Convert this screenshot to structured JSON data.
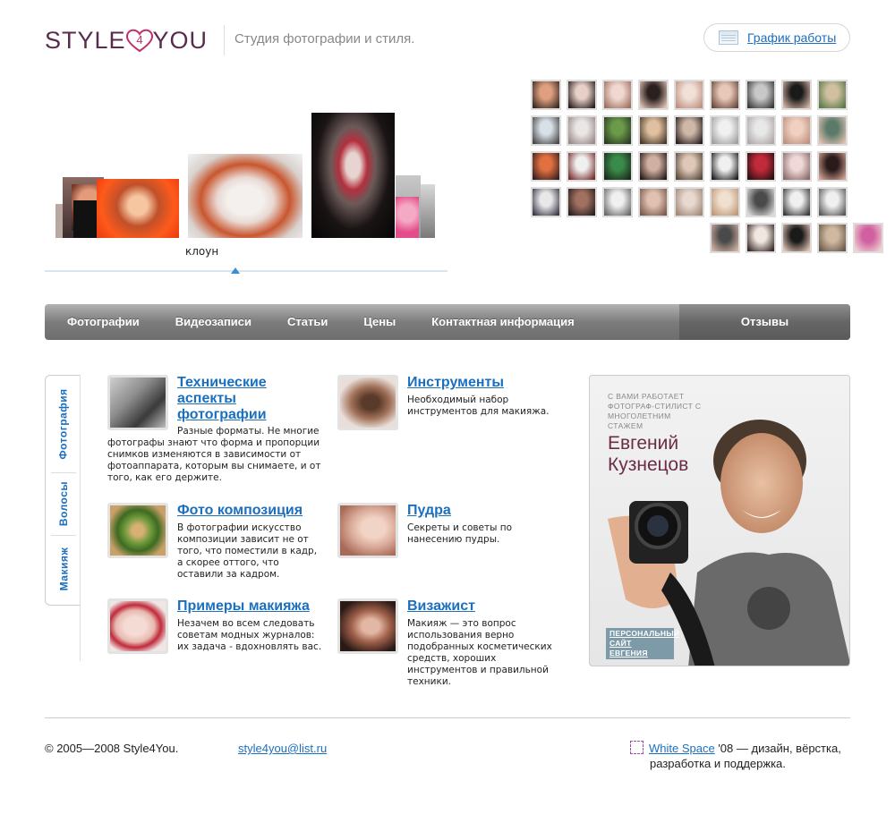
{
  "header": {
    "logo_left": "STYLE",
    "logo_digit": "4",
    "logo_right": "YOU",
    "tagline": "Студия фотографии и стиля.",
    "schedule_label": "График работы",
    "schedule_icon": "calendar-icon"
  },
  "carousel": {
    "active_caption": "клоун"
  },
  "nav": {
    "items": [
      "Фотографии",
      "Видеозаписи",
      "Статьи",
      "Цены",
      "Контактная информация"
    ],
    "reviews": "Отзывы"
  },
  "side_tabs": [
    "Фотография",
    "Волосы",
    "Макияж"
  ],
  "articles": [
    {
      "title": "Технические аспекты фотографии",
      "text": "Разные форматы. Не многие фотографы знают что форма и пропорции снимков изменяются в зависимости от фотоаппарата, которым вы снимаете, и от того, как его держите."
    },
    {
      "title": "Инструменты",
      "text": "Необходимый набор инструментов для макияжа."
    },
    {
      "title": "Фото композиция",
      "text": "В фотографии искусство композиции зависит не от того, что поместили в кадр, а скорее оттого, что оставили за кадром."
    },
    {
      "title": "Пудра",
      "text": "Секреты и советы по нанесению пудры."
    },
    {
      "title": "Примеры макияжа",
      "text": "Незачем во всем следовать советам модных журналов: их задача - вдохновлять вас."
    },
    {
      "title": "Визажист",
      "text": "Макияж — это вопрос использования верно подобранных косметических средств, хороших инструментов и правильной техники."
    }
  ],
  "promo": {
    "intro": "С ВАМИ РАБОТАЕТ ФОТОГРАФ-СТИЛИСТ С МНОГОЛЕТНИМ СТАЖЕМ",
    "name": "Евгений Кузнецов",
    "link": "ПЕРСОНАЛЬНЫЙ САЙТ ЕВГЕНИЯ"
  },
  "footer": {
    "copyright": "© 2005—2008 Style4You.",
    "email": "style4you@list.ru",
    "credit_link": "White Space",
    "credit_rest": " '08 — дизайн, вёрстка,",
    "credit_line2": "разработка и поддержка."
  },
  "colors": {
    "link": "#1b6fbf",
    "brand": "#5b2b4e",
    "heart": "#c0306a"
  }
}
